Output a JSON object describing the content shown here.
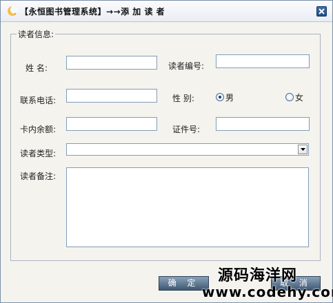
{
  "window": {
    "title": "【永恒图书管理系统】→→添 加 读 者"
  },
  "group": {
    "legend": "读者信息:"
  },
  "fields": {
    "name": {
      "label": "姓   名:",
      "value": ""
    },
    "reader_no": {
      "label": "读者编号:",
      "value": ""
    },
    "phone": {
      "label": "联系电话:",
      "value": ""
    },
    "gender": {
      "label": "性   别:",
      "options": [
        "男",
        "女"
      ],
      "selected": "男"
    },
    "balance": {
      "label": "卡内余额:",
      "value": ""
    },
    "id_no": {
      "label": "证件号:",
      "value": ""
    },
    "reader_type": {
      "label": "读者类型:",
      "value": ""
    },
    "remark": {
      "label": "读者备注:",
      "value": ""
    }
  },
  "buttons": {
    "ok": "确 定",
    "cancel": "取 消"
  },
  "watermark": {
    "line1": "源码海洋网",
    "line2": "www.codehy.com"
  },
  "icons": {
    "app": "moon-logo-icon",
    "close": "close-icon",
    "dropdown": "chevron-down-icon"
  }
}
